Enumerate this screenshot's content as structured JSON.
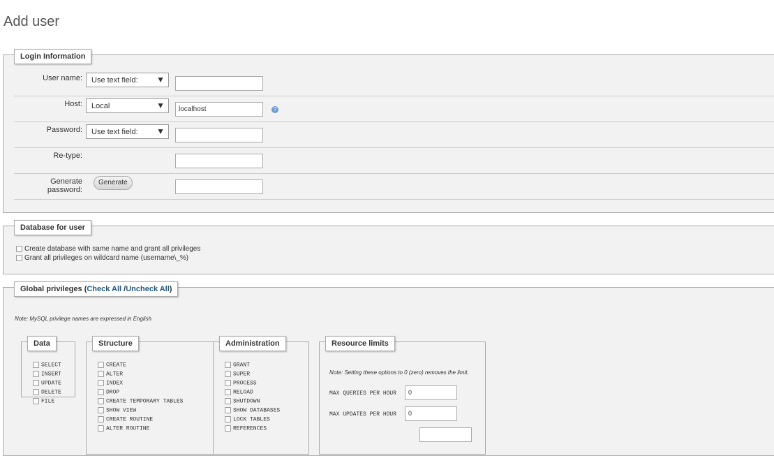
{
  "page": {
    "title": "Add user"
  },
  "login": {
    "legend": "Login Information",
    "username": {
      "label": "User name:",
      "select": "Use text field:",
      "value": ""
    },
    "host": {
      "label": "Host:",
      "select": "Local",
      "value": "localhost",
      "help_icon": "help-icon"
    },
    "password": {
      "label": "Password:",
      "select": "Use text field:",
      "value": ""
    },
    "retype": {
      "label": "Re-type:",
      "value": ""
    },
    "generate": {
      "label": "Generate password:",
      "button": "Generate",
      "value": ""
    }
  },
  "database": {
    "legend": "Database for user",
    "options": [
      {
        "label": "Create database with same name and grant all privileges",
        "checked": false
      },
      {
        "label": "Grant all privileges on wildcard name (username\\_%)",
        "checked": false
      }
    ]
  },
  "global": {
    "legend_prefix": "Global privileges (",
    "check_all": "Check All",
    "separator": " /",
    "uncheck_all": "Uncheck All",
    "legend_suffix": ")",
    "note": "Note: MySQL privilege names are expressed in English",
    "data": {
      "legend": "Data",
      "items": [
        "SELECT",
        "INSERT",
        "UPDATE",
        "DELETE",
        "FILE"
      ]
    },
    "structure": {
      "legend": "Structure",
      "items": [
        "CREATE",
        "ALTER",
        "INDEX",
        "DROP",
        "CREATE TEMPORARY TABLES",
        "SHOW VIEW",
        "CREATE ROUTINE",
        "ALTER ROUTINE"
      ]
    },
    "administration": {
      "legend": "Administration",
      "items": [
        "GRANT",
        "SUPER",
        "PROCESS",
        "RELOAD",
        "SHUTDOWN",
        "SHOW DATABASES",
        "LOCK TABLES",
        "REFERENCES"
      ]
    },
    "resource": {
      "legend": "Resource limits",
      "note": "Note: Setting these options to 0 (zero) removes the limit.",
      "items": [
        {
          "label": "MAX QUERIES PER HOUR",
          "value": "0"
        },
        {
          "label": "MAX UPDATES PER HOUR",
          "value": "0"
        }
      ]
    }
  }
}
